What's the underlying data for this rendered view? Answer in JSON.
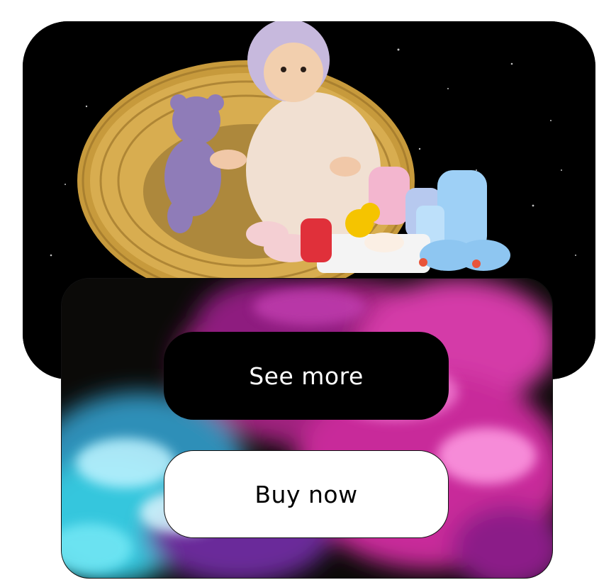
{
  "buttons": {
    "see_more": "See more",
    "buy_now": "Buy now"
  },
  "colors": {
    "dark_button_bg": "#000000",
    "dark_button_text": "#ffffff",
    "light_button_bg": "#ffffff",
    "light_button_text": "#000000",
    "smoke_pink": "#d5329f",
    "smoke_cyan": "#3fd4e6"
  }
}
